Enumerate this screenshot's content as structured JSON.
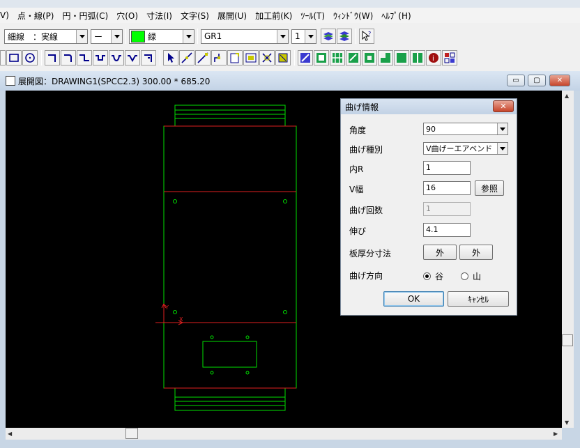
{
  "menu": [
    "V)",
    "点・線(P)",
    "円・円弧(C)",
    "穴(O)",
    "寸法(I)",
    "文字(S)",
    "展開(U)",
    "加工前(K)",
    "ﾂｰﾙ(T)",
    "ｳｨﾝﾄﾞｳ(W)",
    "ﾍﾙﾌﾟ(H)"
  ],
  "toolbar": {
    "line_type_value": "細線　：実線",
    "line_style_value": "ー",
    "color_value": "緑",
    "color_hex": "#00ff00",
    "group_value": "GR1",
    "number_value": "1"
  },
  "window": {
    "title": "展開図：DRAWING1(SPCC2.3) 300.00 * 685.20",
    "minimize": "▭",
    "restore": "▢",
    "close": "✕"
  },
  "drawing": {
    "axis_x": "X",
    "axis_y": "Y"
  },
  "dialog": {
    "title": "曲げ情報",
    "close": "✕",
    "angle_label": "角度",
    "angle_value": "90",
    "bend_type_label": "曲げ種別",
    "bend_type_value": "V曲げーエアベンド",
    "inner_r_label": "内R",
    "inner_r_value": "1",
    "v_width_label": "V幅",
    "v_width_value": "16",
    "reference_button": "参照",
    "bend_count_label": "曲げ回数",
    "bend_count_value": "1",
    "elongation_label": "伸び",
    "elongation_value": "4.1",
    "thickness_dim_label": "板厚分寸法",
    "thickness_btn_1": "外",
    "thickness_btn_2": "外",
    "direction_label": "曲げ方向",
    "direction_valley": "谷",
    "direction_mountain": "山",
    "direction_selected": "valley",
    "ok_button": "OK",
    "cancel_button": "ｷｬﾝｾﾙ"
  }
}
